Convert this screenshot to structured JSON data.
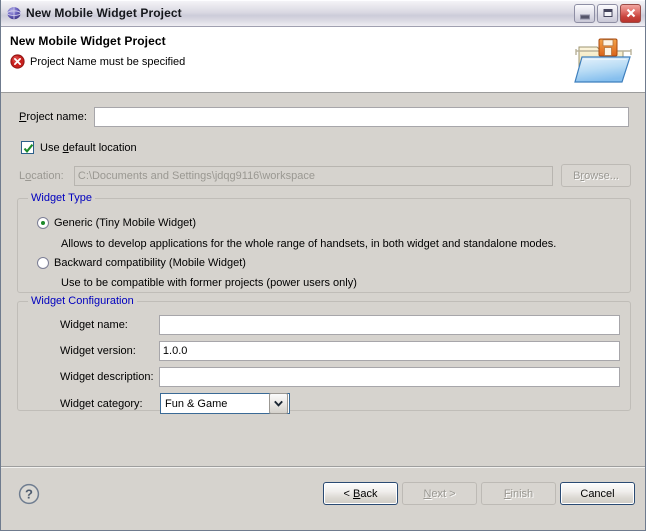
{
  "window": {
    "title": "New Mobile Widget Project",
    "icon": "globe-icon",
    "minimize_label": "Minimize",
    "maximize_label": "Maximize",
    "close_label": "Close"
  },
  "header": {
    "title": "New Mobile Widget Project",
    "error_icon": "error-circle-icon",
    "error_message": "Project Name must be specified",
    "graphic": "folder-with-save-disk-icon"
  },
  "form": {
    "project_name": {
      "label_pre": "P",
      "label_post": "roject name:",
      "value": "",
      "placeholder": ""
    },
    "use_default_location": {
      "label_pre": "Use ",
      "label_mn": "d",
      "label_post": "efault location",
      "checked": true,
      "check_icon": "checkmark-icon"
    },
    "location": {
      "label_pre": "L",
      "label_mn": "o",
      "label_post": "cation:",
      "value": "C:\\Documents and Settings\\jdqg9116\\workspace",
      "enabled": false
    },
    "browse_button": {
      "label_pre": "B",
      "label_mn": "r",
      "label_post": "owse...",
      "enabled": false
    }
  },
  "widget_type": {
    "legend": "Widget Type",
    "options": [
      {
        "label": "Generic (Tiny Mobile Widget)",
        "selected": true,
        "hint": "Allows to develop applications for the whole range of handsets, in both widget and standalone modes."
      },
      {
        "label": "Backward compatibility (Mobile Widget)",
        "selected": false,
        "hint": "Use to be compatible with former projects (power users only)"
      }
    ]
  },
  "widget_configuration": {
    "legend": "Widget Configuration",
    "fields": [
      {
        "label": "Widget name:",
        "value": "",
        "type": "text"
      },
      {
        "label": "Widget version:",
        "value": "1.0.0",
        "type": "text"
      },
      {
        "label": "Widget description:",
        "value": "",
        "type": "text"
      }
    ],
    "category": {
      "label": "Widget category:",
      "value": "Fun & Game",
      "dropdown_icon": "chevron-down-icon"
    }
  },
  "footer": {
    "help_icon": "help-question-icon",
    "buttons": [
      {
        "name": "back",
        "label_pre": "< ",
        "label_mn": "B",
        "label_post": "ack",
        "enabled": true,
        "is_default": true
      },
      {
        "name": "next",
        "label_pre": "",
        "label_mn": "N",
        "label_post": "ext >",
        "enabled": false,
        "is_default": false
      },
      {
        "name": "finish",
        "label_pre": "",
        "label_mn": "F",
        "label_post": "inish",
        "enabled": false,
        "is_default": false
      },
      {
        "name": "cancel",
        "label_pre": "",
        "label_mn": "",
        "label_post": "Cancel",
        "enabled": true,
        "is_default": true
      }
    ]
  },
  "colors": {
    "group_legend": "#0000bf",
    "dialog_bg": "#d6d3ce",
    "error_red": "#c8201e",
    "radio_green": "#1d8a2b"
  }
}
